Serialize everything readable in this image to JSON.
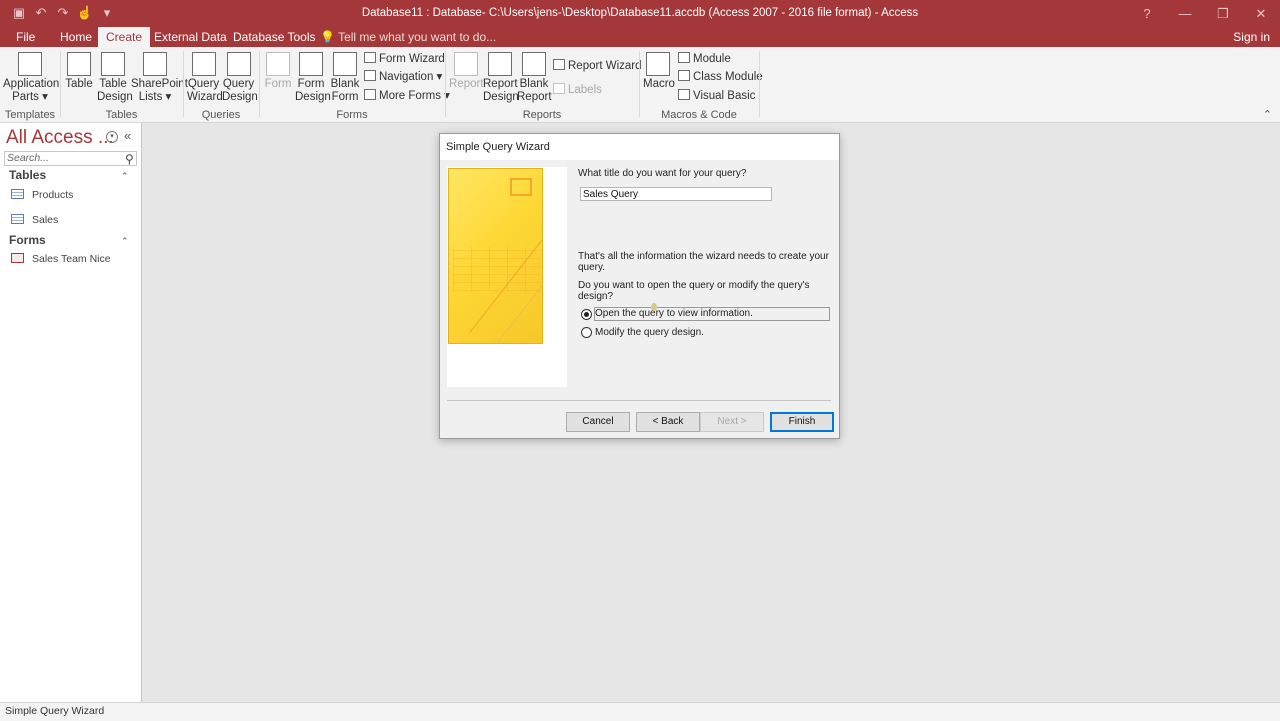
{
  "window": {
    "title": "Database11 : Database- C:\\Users\\jens-\\Desktop\\Database11.accdb (Access 2007 - 2016 file format) - Access",
    "qat_icons": [
      "save-icon",
      "undo-icon",
      "redo-icon",
      "touch-mode-icon",
      "customize-qat-icon"
    ],
    "controls": [
      "?",
      "—",
      "❐",
      "✕"
    ]
  },
  "tabs": [
    "File",
    "Home",
    "Create",
    "External Data",
    "Database Tools"
  ],
  "active_tab": "Create",
  "tell_me": "Tell me what you want to do...",
  "sign_in": "Sign in",
  "ribbon": {
    "templates": {
      "app_parts_line1": "Application",
      "app_parts_line2": "Parts",
      "group": "Templates"
    },
    "tables": {
      "table": "Table",
      "table_design_1": "Table",
      "table_design_2": "Design",
      "sharepoint_1": "SharePoint",
      "sharepoint_2": "Lists",
      "group": "Tables"
    },
    "queries": {
      "qw_1": "Query",
      "qw_2": "Wizard",
      "qd_1": "Query",
      "qd_2": "Design",
      "group": "Queries"
    },
    "forms": {
      "form": "Form",
      "fd_1": "Form",
      "fd_2": "Design",
      "bf_1": "Blank",
      "bf_2": "Form",
      "form_wizard": "Form Wizard",
      "navigation": "Navigation",
      "more_forms": "More Forms",
      "group": "Forms"
    },
    "reports": {
      "report": "Report",
      "rd_1": "Report",
      "rd_2": "Design",
      "br_1": "Blank",
      "br_2": "Report",
      "report_wizard": "Report Wizard",
      "labels": "Labels",
      "group": "Reports"
    },
    "macros": {
      "macro": "Macro",
      "module": "Module",
      "class_module": "Class Module",
      "visual_basic": "Visual Basic",
      "group": "Macros & Code"
    }
  },
  "nav": {
    "title": "All Access ...",
    "search_placeholder": "Search...",
    "groups": [
      {
        "label": "Tables",
        "items": [
          "Products",
          "Sales"
        ]
      },
      {
        "label": "Forms",
        "items": [
          "Sales Team Nice"
        ]
      }
    ]
  },
  "dialog": {
    "title": "Simple Query Wizard",
    "question_title": "What title do you want for your query?",
    "query_title_value": "Sales Query",
    "info": "That's all the information the wizard needs to create your query.",
    "question_open": "Do you want to open the query or modify the query's design?",
    "option_open": "Open the query to view information.",
    "option_modify": "Modify the query design.",
    "selected_option": "open",
    "buttons": {
      "cancel": "Cancel",
      "back": "< Back",
      "next": "Next >",
      "finish": "Finish"
    }
  },
  "status": "Simple Query Wizard"
}
